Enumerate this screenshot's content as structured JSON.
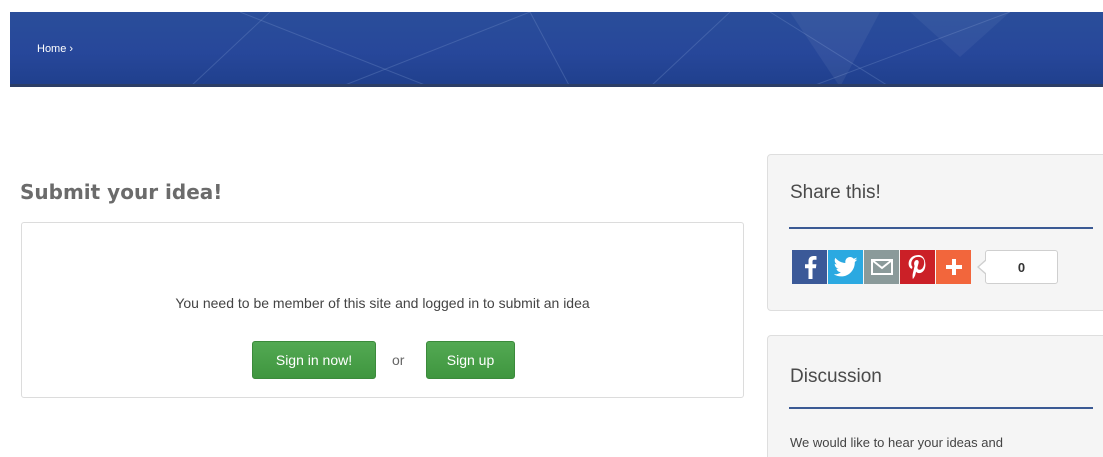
{
  "breadcrumb": {
    "home_label": "Home",
    "separator": "›"
  },
  "main": {
    "title": "Submit your idea!",
    "message": "You need to be member of this site and logged in to submit an idea",
    "signin_label": "Sign in now!",
    "or_label": "or",
    "signup_label": "Sign up"
  },
  "share": {
    "title": "Share this!",
    "count": "0",
    "icons": [
      "facebook-icon",
      "twitter-icon",
      "email-icon",
      "pinterest-icon",
      "plus-icon"
    ]
  },
  "discussion": {
    "title": "Discussion",
    "text": "We would like to hear your ideas and"
  },
  "colors": {
    "banner": "#27479a",
    "button_green": "#47a047",
    "accent_rule": "#3b5a94",
    "facebook": "#3b5998",
    "twitter": "#2ba9e1",
    "email": "#8a9a9a",
    "pinterest": "#cb2027",
    "plus": "#f2663c"
  }
}
